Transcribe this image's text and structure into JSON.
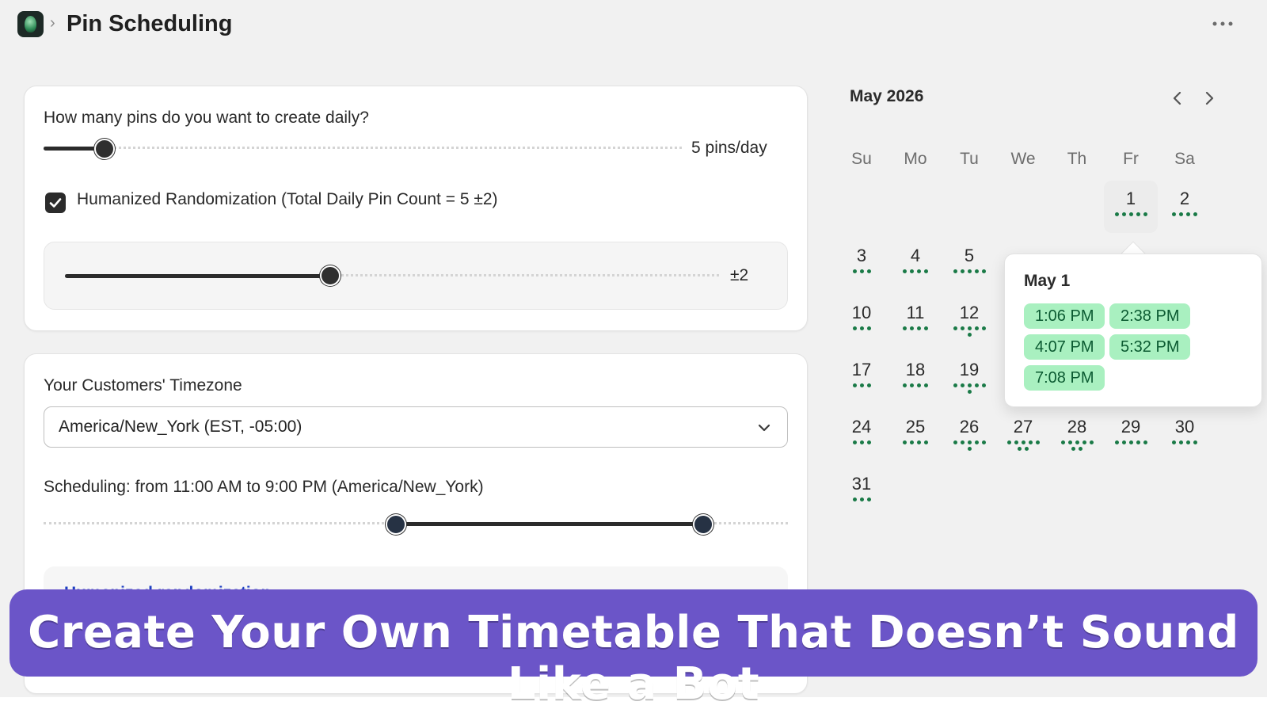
{
  "header": {
    "breadcrumb_separator": "›",
    "title": "Pin Scheduling",
    "more_icon": "more-horizontal-icon",
    "logo_icon": "app-logo-icon"
  },
  "pins_card": {
    "question": "How many pins do you want to create daily?",
    "pins_per_day_value": 5,
    "pins_per_day_text": "5 pins/day",
    "randomization_checked": true,
    "randomization_label": "Humanized Randomization (Total Daily Pin Count = 5 ±2)",
    "variance_value_text": "±2",
    "variance_fraction": 0.4
  },
  "timezone_card": {
    "label": "Your Customers' Timezone",
    "selected_timezone": "America/New_York (EST, -05:00)",
    "scheduling_text": "Scheduling: from 11:00 AM to 9:00 PM (America/New_York)",
    "range_start_hour": 11,
    "range_end_hour": 21,
    "sub_panel_title": "Humanized randomization"
  },
  "calendar": {
    "month_label": "May 2026",
    "prev_icon": "chevron-left-icon",
    "next_icon": "chevron-right-icon",
    "weekdays": [
      "Su",
      "Mo",
      "Tu",
      "We",
      "Th",
      "Fr",
      "Sa"
    ],
    "days": [
      {
        "n": "1",
        "pins": 5
      },
      {
        "n": "2",
        "pins": 4
      },
      {
        "n": "3",
        "pins": 3
      },
      {
        "n": "4",
        "pins": 4
      },
      {
        "n": "5",
        "pins": 5
      },
      {
        "n": "10",
        "pins": 3
      },
      {
        "n": "11",
        "pins": 4
      },
      {
        "n": "12",
        "pins": 6
      },
      {
        "n": "17",
        "pins": 3
      },
      {
        "n": "18",
        "pins": 4
      },
      {
        "n": "19",
        "pins": 6
      },
      {
        "n": "24",
        "pins": 3
      },
      {
        "n": "25",
        "pins": 4
      },
      {
        "n": "26",
        "pins": 6
      },
      {
        "n": "27",
        "pins": 7
      },
      {
        "n": "28",
        "pins": 7
      },
      {
        "n": "29",
        "pins": 5
      },
      {
        "n": "30",
        "pins": 4
      },
      {
        "n": "31",
        "pins": 3
      }
    ],
    "selected_day": "1",
    "popover": {
      "title": "May 1",
      "times": [
        "1:06 PM",
        "2:38 PM",
        "4:07 PM",
        "5:32 PM",
        "7:08 PM"
      ]
    }
  },
  "banner": {
    "text": "Create Your Own Timetable That Doesn’t Sound Like a Bot",
    "color": "#6b55c8"
  },
  "colors": {
    "accent_dark": "#2b2b2b",
    "dot_green": "#1a7a47",
    "chip_green": "#a9f0c0",
    "link_blue": "#1d3fc2"
  }
}
